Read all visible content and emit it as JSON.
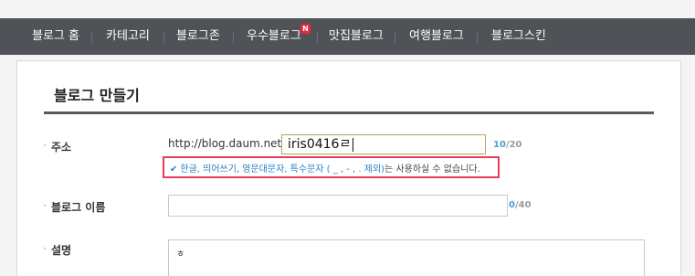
{
  "nav": {
    "items": [
      {
        "label": "블로그 홈"
      },
      {
        "label": "카테고리"
      },
      {
        "label": "블로그존"
      },
      {
        "label": "우수블로그",
        "badge": "N"
      },
      {
        "label": "맛집블로그"
      },
      {
        "label": "여행블로그"
      },
      {
        "label": "블로그스킨"
      }
    ]
  },
  "page": {
    "title": "블로그 만들기"
  },
  "form": {
    "address": {
      "label": "주소",
      "prefix": "http://blog.daum.net/",
      "value": "iris0416ㄹ",
      "count_current": "10",
      "count_max": "/20",
      "notice_highlight": "한글, 띄어쓰기, 영문대문자, 특수문자 ( _ , - , . 제외)",
      "notice_rest": "는 사용하실 수 없습니다."
    },
    "blog_name": {
      "label": "블로그 이름",
      "value": "",
      "count_current": "0",
      "count_max": "/40"
    },
    "description": {
      "label": "설명",
      "value": "ㅎ"
    }
  },
  "colors": {
    "nav_bg": "#4f5257",
    "badge": "#e8243f",
    "highlight_border": "#e53d61",
    "accent_blue": "#2b7fc2"
  },
  "icons": {
    "notice": "check-icon",
    "new": "new-badge"
  }
}
